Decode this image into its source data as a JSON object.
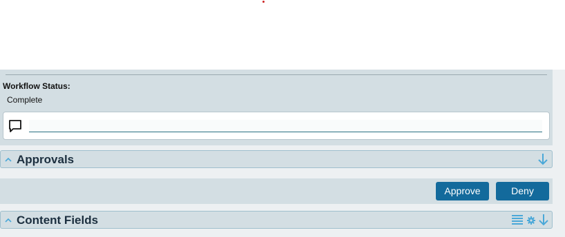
{
  "workflow": {
    "status_label": "Workflow Status:",
    "status_value": "Complete",
    "comment_placeholder": ""
  },
  "icons": {
    "comment": "comment-icon",
    "collapse": "chevron-up-icon",
    "move_down": "arrow-down-icon",
    "list": "list-icon",
    "settings": "gear-icon"
  },
  "approvals": {
    "title": "Approvals"
  },
  "actions": {
    "approve_label": "Approve",
    "deny_label": "Deny"
  },
  "content_fields": {
    "title": "Content Fields"
  },
  "colors": {
    "panel_bg": "#d3dee3",
    "button_bg": "#136a9c",
    "icon_blue": "#4aa8d8",
    "indicator_dot": "#cc2020"
  }
}
